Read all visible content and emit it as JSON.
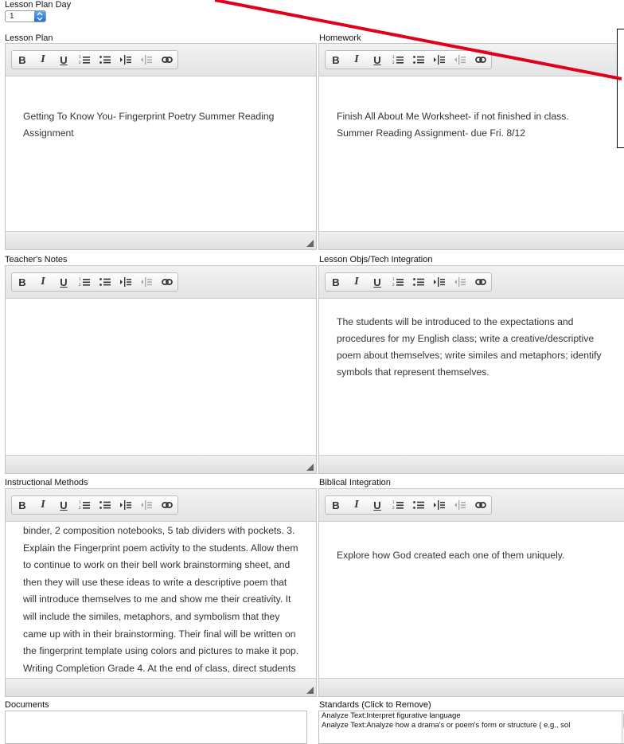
{
  "lesson_plan_day": {
    "label": "Lesson Plan Day",
    "value": "1"
  },
  "toolbar_buttons": [
    {
      "name": "bold",
      "label": "B"
    },
    {
      "name": "italic",
      "label": "I"
    },
    {
      "name": "underline",
      "label": "U"
    },
    {
      "name": "ordered-list",
      "icon": "ordered-list-icon"
    },
    {
      "name": "unordered-list",
      "icon": "unordered-list-icon"
    },
    {
      "name": "indent",
      "icon": "indent-icon"
    },
    {
      "name": "outdent",
      "icon": "outdent-icon"
    },
    {
      "name": "link",
      "icon": "link-icon"
    }
  ],
  "lesson_plan": {
    "label": "Lesson Plan",
    "content": "Getting To Know You- Fingerprint Poetry Summer Reading Assignment"
  },
  "homework": {
    "label": "Homework",
    "lines": [
      "Finish All About Me Worksheet- if not finished in class.",
      "Summer Reading Assignment- due Fri. 8/12"
    ]
  },
  "teachers_notes": {
    "label": "Teacher's Notes",
    "content": ""
  },
  "lesson_objs": {
    "label": "Lesson Objs/Tech Integration",
    "content": "The students will be introduced to the expectations and procedures for my English class; write a creative/descriptive poem about themselves; write similes and metaphors; identify symbols that represent themselves."
  },
  "instructional_methods": {
    "label": "Instructional Methods",
    "content": "binder, 2 composition notebooks, 5 tab dividers with pockets. 3. Explain the Fingerprint poem activity to the students. Allow them to continue to work on their bell work brainstorming sheet, and then they will use these ideas to write a descriptive poem that will introduce themselves to me and show me their creativity. It will include the similes, metaphors, and symbolism that they came up with in their brainstorming. Their final will be written on the fingerprint template using colors and pictures to make it pop. Writing Completion Grade 4. At the end of class, direct students to"
  },
  "biblical_integration": {
    "label": "Biblical Integration",
    "content": "Explore how God created each one of them uniquely."
  },
  "documents": {
    "label": "Documents"
  },
  "standards": {
    "label": "Standards (Click to Remove)",
    "items": [
      "Analyze Text:Interpret figurative language",
      "Analyze Text:Analyze how a drama's or poem's form or structure ( e.g., sol"
    ]
  },
  "colors": {
    "annotation_arrow": "#e0001b",
    "select_accent": "#2a7de8"
  }
}
